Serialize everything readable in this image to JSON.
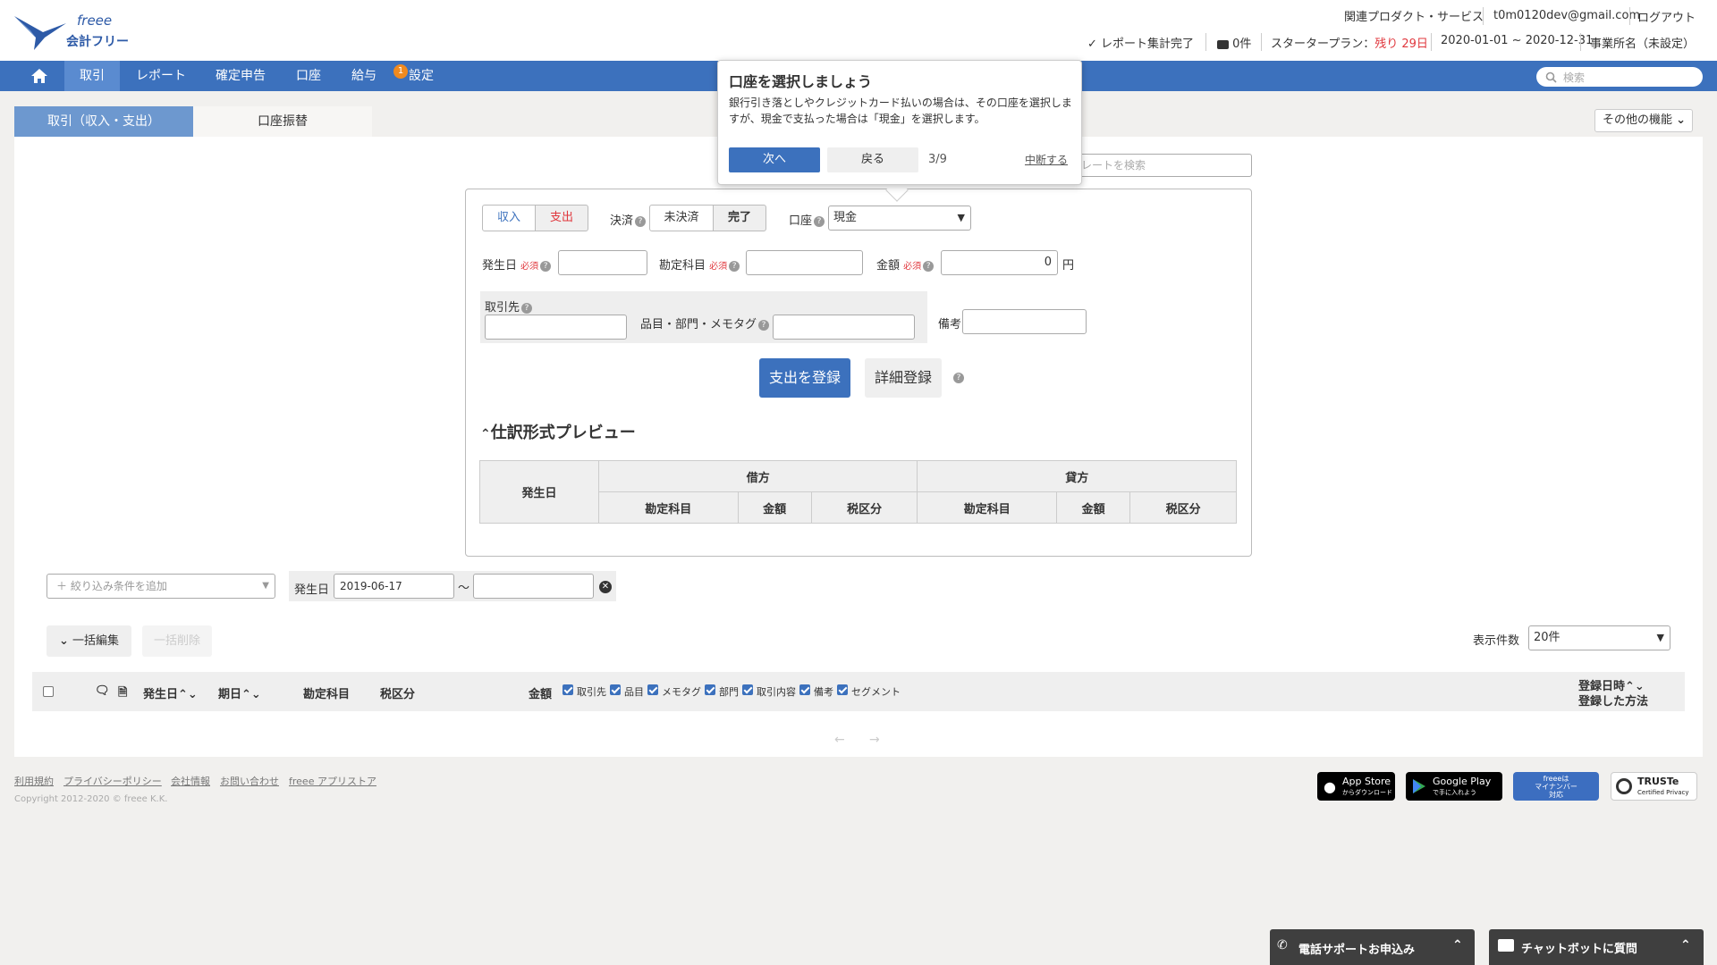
{
  "header": {
    "logo_freee": "freee",
    "logo_name": "会計フリー",
    "related_products": "関連プロダクト・サービス",
    "email": "t0m0120dev@gmail.com",
    "logout": "ログアウト",
    "report_status": "レポート集計完了",
    "notifications": "0件",
    "plan_label": "スタータープラン：",
    "plan_remaining": "残り 29日",
    "fiscal_period": "2020-01-01 ~ 2020-12-31",
    "office_name": "事業所名（未設定）"
  },
  "nav": {
    "items": [
      "取引",
      "レポート",
      "確定申告",
      "口座",
      "給与",
      "設定"
    ],
    "settings_badge": "1",
    "search_placeholder": "検索"
  },
  "tabs": {
    "transactions": "取引（収入・支出）",
    "transfer": "口座振替",
    "other_features": "その他の機能"
  },
  "tooltip": {
    "title": "口座を選択しましょう",
    "body": "銀行引き落としやクレジットカード払いの場合は、その口座を選択しますが、現金で支払った場合は「現金」を選択します。",
    "next": "次へ",
    "back": "戻る",
    "step": "3/9",
    "abort": "中断する"
  },
  "template_search_placeholder": "プレートを検索",
  "form": {
    "income": "収入",
    "expense": "支出",
    "settlement_label": "決済",
    "unsettled": "未決済",
    "settled": "完了",
    "account_label": "口座",
    "account_value": "現金",
    "date_label": "発生日",
    "required": "必須",
    "account_item_label": "勘定科目",
    "amount_label": "金額",
    "amount_value": "0",
    "currency": "円",
    "partner_label": "取引先",
    "item_label": "品目・部門・メモタグ",
    "remarks_label": "備考",
    "register_button": "支出を登録",
    "detail_button": "詳細登録",
    "preview_title": "仕訳形式プレビュー",
    "preview": {
      "date": "発生日",
      "debit": "借方",
      "credit": "貸方",
      "account": "勘定科目",
      "amount": "金額",
      "tax": "税区分"
    }
  },
  "filter": {
    "add_condition": "＋ 絞り込み条件を追加",
    "date_label": "発生日",
    "date_from": "2019-06-17",
    "tilde": "〜"
  },
  "list": {
    "bulk_edit": "一括編集",
    "bulk_delete": "一括削除",
    "per_page_label": "表示件数",
    "per_page_value": "20件",
    "col_date": "発生日",
    "col_due": "期日",
    "col_account": "勘定科目",
    "col_tax": "税区分",
    "col_amount": "金額",
    "toggles": [
      "取引先",
      "品目",
      "メモタグ",
      "部門",
      "取引内容",
      "備考",
      "セグメント"
    ],
    "col_registered_at": "登録日時",
    "col_registered_method": "登録した方法"
  },
  "footer": {
    "links": [
      "利用規約",
      "プライバシーポリシー",
      "会社情報",
      "お問い合わせ",
      "freee アプリストア"
    ],
    "copyright": "Copyright 2012-2020 © freee K.K.",
    "app_store": "App Store",
    "app_store_sub": "からダウンロード",
    "google_play": "Google Play",
    "google_play_sub": "で手に入れよう",
    "mynumber_1": "freeeは",
    "mynumber_2": "マイナンバー",
    "mynumber_3": "対応",
    "truste": "TRUSTe",
    "truste_sub": "Certified Privacy"
  },
  "bottom": {
    "phone_support": "電話サポートお申込み",
    "chatbot": "チャットボットに質問"
  },
  "colors": {
    "brand_blue": "#3c71bd",
    "accent_red": "#e0383e",
    "badge_orange": "#f08a1f"
  }
}
